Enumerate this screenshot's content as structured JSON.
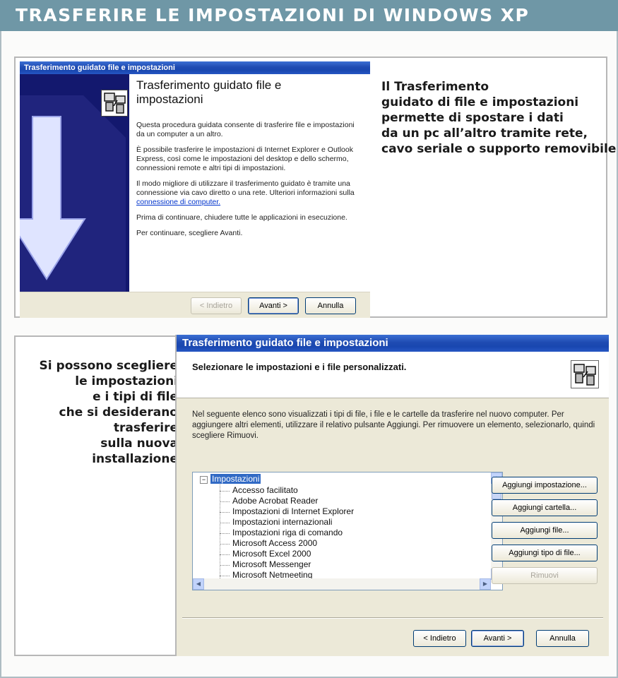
{
  "article": {
    "title": "TRASFERIRE LE IMPOSTAZIONI DI WINDOWS XP"
  },
  "caption1": [
    "Il Trasferimento",
    "guidato di file e impostazioni",
    "permette di spostare i dati",
    "da un pc all’altro tramite rete,",
    "cavo seriale o supporto removibile"
  ],
  "caption2": [
    "Si possono scegliere",
    "le impostazioni",
    "e i tipi di file",
    "che si desiderano",
    "trasferire",
    "sulla nuova",
    "installazione"
  ],
  "wizard1": {
    "window_title": "Trasferimento guidato file e impostazioni",
    "heading_line1": "Trasferimento guidato file e",
    "heading_line2": "impostazioni",
    "p1": "Questa procedura guidata consente di trasferire file e impostazioni da un computer a un altro.",
    "p2": "È possibile trasferire le impostazioni di Internet Explorer e Outlook Express, così come le impostazioni del desktop e dello schermo, connessioni remote e altri tipi di impostazioni.",
    "p3_pre": "Il modo migliore di utilizzare il trasferimento guidato è tramite una connessione via cavo diretto o una rete. Ulteriori informazioni sulla ",
    "p3_link": "connessione di computer.",
    "p4": "Prima di continuare, chiudere tutte le applicazioni in esecuzione.",
    "p5": "Per continuare, scegliere Avanti.",
    "btn_back": "< Indietro",
    "btn_next": "Avanti >",
    "btn_cancel": "Annulla"
  },
  "wizard2": {
    "window_title": "Trasferimento guidato file e impostazioni",
    "header_title": "Selezionare le impostazioni e i file personalizzati.",
    "description": "Nel seguente elenco sono visualizzati i tipi di file, i file e le cartelle da trasferire nel nuovo computer. Per aggiungere altri elementi, utilizzare il relativo pulsante Aggiungi. Per rimuovere un elemento, selezionarlo, quindi scegliere Rimuovi.",
    "tree_root": "Impostazioni",
    "tree_items": [
      "Accesso facilitato",
      "Adobe Acrobat Reader",
      "Impostazioni di Internet Explorer",
      "Impostazioni internazionali",
      "Impostazioni riga di comando",
      "Microsoft Access 2000",
      "Microsoft Excel 2000",
      "Microsoft Messenger",
      "Microsoft Netmeeting"
    ],
    "btn_add_setting": "Aggiungi impostazione...",
    "btn_add_folder": "Aggiungi cartella...",
    "btn_add_file": "Aggiungi file...",
    "btn_add_filetype": "Aggiungi tipo di file...",
    "btn_remove": "Rimuovi",
    "btn_back": "< Indietro",
    "btn_next": "Avanti >",
    "btn_cancel": "Annulla"
  }
}
